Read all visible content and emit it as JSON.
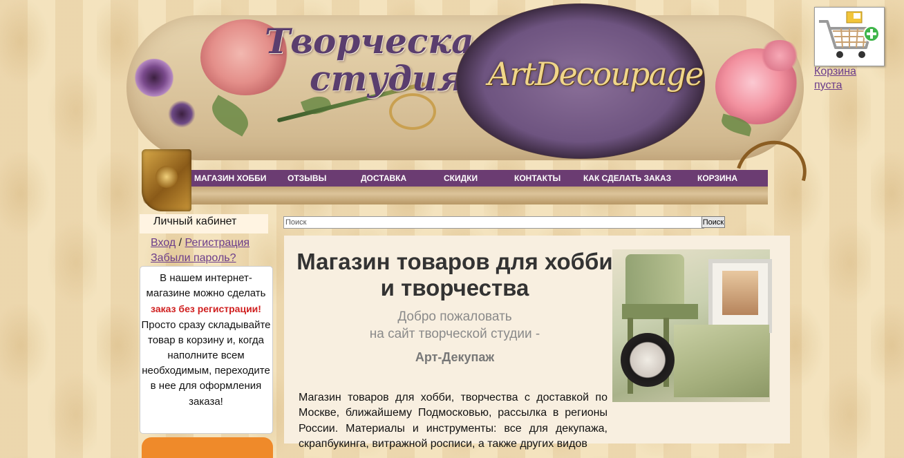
{
  "header": {
    "logo_line1": "Творческая",
    "logo_line2": "студия",
    "medallion_text": "ArtDecoupage"
  },
  "nav": {
    "items": [
      {
        "label": "МАГАЗИН ХОББИ"
      },
      {
        "label": "ОТЗЫВЫ"
      },
      {
        "label": "ДОСТАВКА"
      },
      {
        "label": "СКИДКИ"
      },
      {
        "label": "КОНТАКТЫ"
      },
      {
        "label": "КАК СДЕЛАТЬ ЗАКАЗ"
      },
      {
        "label": "КОРЗИНА"
      }
    ]
  },
  "cart": {
    "status_line1": "Корзина",
    "status_line2": "пуста",
    "icon": "shopping-cart-add-icon"
  },
  "sidebar": {
    "cabinet_title": "Личный кабинет",
    "login_link": "Вход",
    "separator": " / ",
    "register_link": "Регистрация",
    "forgot_link": "Забыли пароль?",
    "info_text_before": "В нашем интернет-магазине можно сделать ",
    "info_highlight": "заказ без регистрации!",
    "info_text_after": " Просто сразу складывайте товар в корзину и, когда наполните всем необходимым, переходите в нее для оформления заказа!"
  },
  "search": {
    "placeholder": "Поиск",
    "button_label": "Поиск"
  },
  "main": {
    "title": "Магазин товаров для хобби и творчества",
    "welcome_line1": "Добро пожаловать",
    "welcome_line2": "на сайт творческой студии -",
    "brand": "Арт-Декупаж",
    "description": "Магазин товаров для хобби, творчества с доставкой по Москве, ближайшему Подмосковью, рассылка в регионы России. Материалы и инструменты: все для декупажа, скрапбукинга, витражной росписи, а также других видов"
  },
  "colors": {
    "nav_bg": "#6b3c72",
    "link": "#6b3c8a",
    "highlight_red": "#d02020",
    "page_bg": "#f1dfb8"
  }
}
